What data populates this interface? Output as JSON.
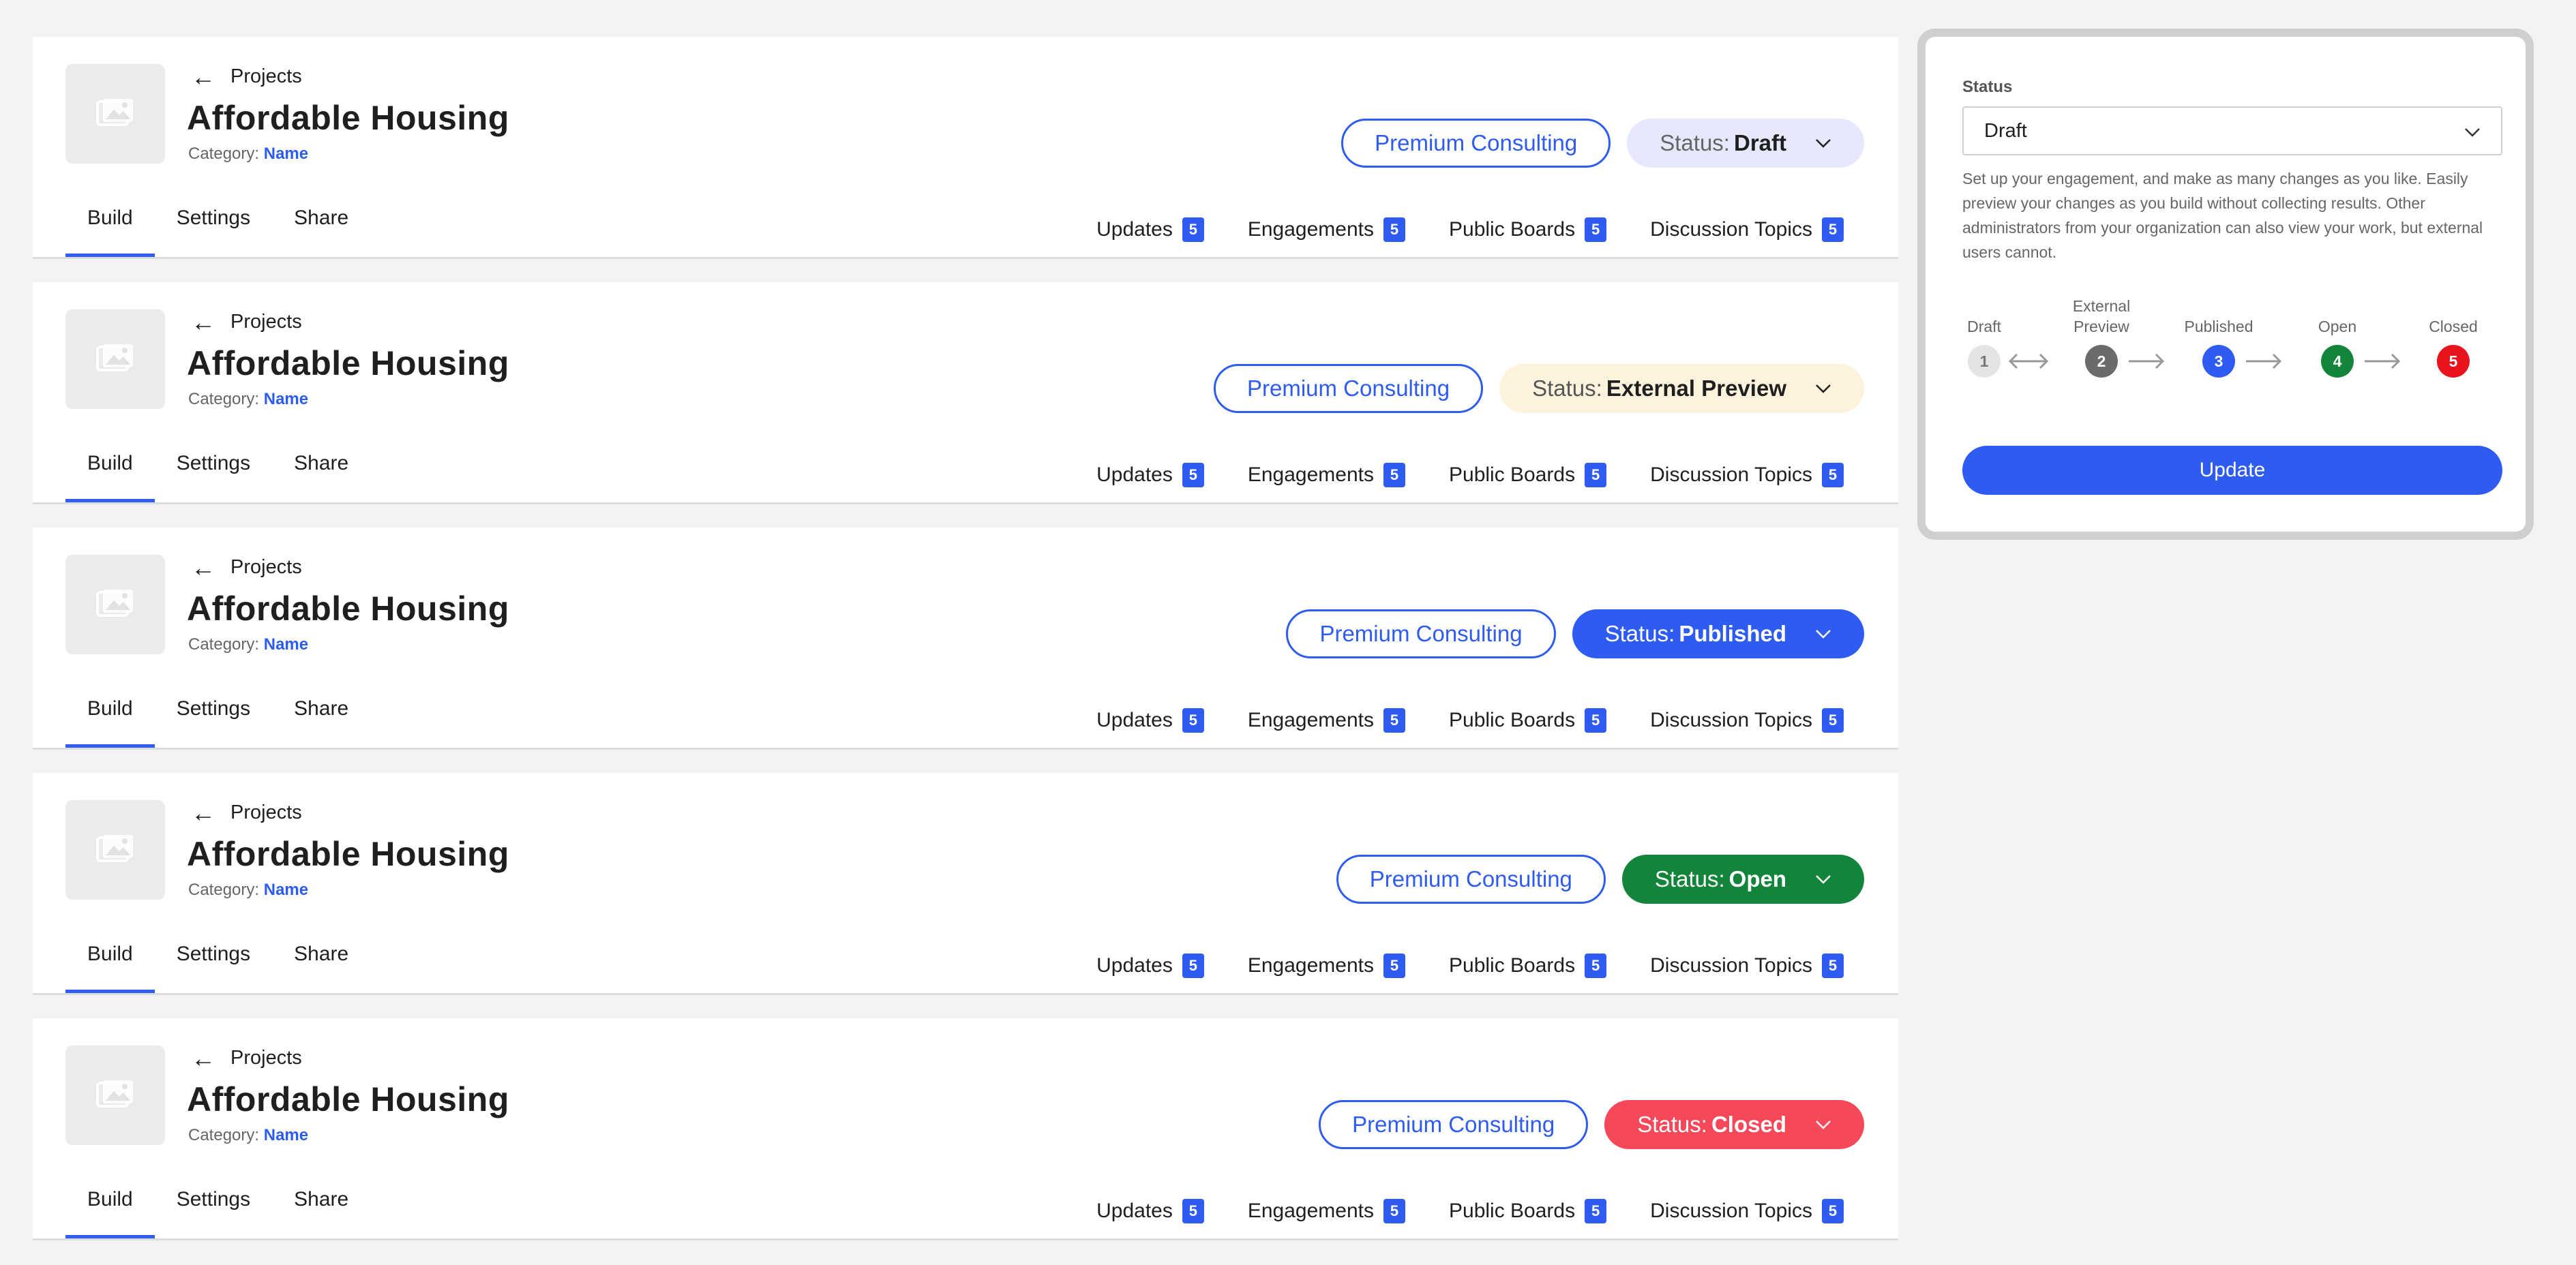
{
  "cards": [
    {
      "back_label": "Projects",
      "title": "Affordable Housing",
      "category_prefix": "Category:",
      "category_name": "Name",
      "premium_label": "Premium Consulting",
      "status_prefix": "Status:",
      "status_value": "Draft",
      "status_bg": "#e6e8fb",
      "status_fg": "#666666",
      "status_value_fg": "#1f1f1f",
      "tabs": [
        "Build",
        "Settings",
        "Share"
      ],
      "counts": [
        {
          "label": "Updates",
          "count": "5"
        },
        {
          "label": "Engagements",
          "count": "5"
        },
        {
          "label": "Public Boards",
          "count": "5"
        },
        {
          "label": "Discussion Topics",
          "count": "5"
        }
      ]
    },
    {
      "back_label": "Projects",
      "title": "Affordable Housing",
      "category_prefix": "Category:",
      "category_name": "Name",
      "premium_label": "Premium Consulting",
      "status_prefix": "Status:",
      "status_value": "External Preview",
      "status_bg": "#fdf3dc",
      "status_fg": "#555555",
      "status_value_fg": "#1f1f1f",
      "tabs": [
        "Build",
        "Settings",
        "Share"
      ],
      "counts": [
        {
          "label": "Updates",
          "count": "5"
        },
        {
          "label": "Engagements",
          "count": "5"
        },
        {
          "label": "Public Boards",
          "count": "5"
        },
        {
          "label": "Discussion Topics",
          "count": "5"
        }
      ]
    },
    {
      "back_label": "Projects",
      "title": "Affordable Housing",
      "category_prefix": "Category:",
      "category_name": "Name",
      "premium_label": "Premium Consulting",
      "status_prefix": "Status:",
      "status_value": "Published",
      "status_bg": "#2f5cf0",
      "status_fg": "#ffffff",
      "status_value_fg": "#ffffff",
      "tabs": [
        "Build",
        "Settings",
        "Share"
      ],
      "counts": [
        {
          "label": "Updates",
          "count": "5"
        },
        {
          "label": "Engagements",
          "count": "5"
        },
        {
          "label": "Public Boards",
          "count": "5"
        },
        {
          "label": "Discussion Topics",
          "count": "5"
        }
      ]
    },
    {
      "back_label": "Projects",
      "title": "Affordable Housing",
      "category_prefix": "Category:",
      "category_name": "Name",
      "premium_label": "Premium Consulting",
      "status_prefix": "Status:",
      "status_value": "Open",
      "status_bg": "#13853a",
      "status_fg": "#ffffff",
      "status_value_fg": "#ffffff",
      "tabs": [
        "Build",
        "Settings",
        "Share"
      ],
      "counts": [
        {
          "label": "Updates",
          "count": "5"
        },
        {
          "label": "Engagements",
          "count": "5"
        },
        {
          "label": "Public Boards",
          "count": "5"
        },
        {
          "label": "Discussion Topics",
          "count": "5"
        }
      ]
    },
    {
      "back_label": "Projects",
      "title": "Affordable Housing",
      "category_prefix": "Category:",
      "category_name": "Name",
      "premium_label": "Premium Consulting",
      "status_prefix": "Status:",
      "status_value": "Closed",
      "status_bg": "#f64859",
      "status_fg": "#ffffff",
      "status_value_fg": "#ffffff",
      "tabs": [
        "Build",
        "Settings",
        "Share"
      ],
      "counts": [
        {
          "label": "Updates",
          "count": "5"
        },
        {
          "label": "Engagements",
          "count": "5"
        },
        {
          "label": "Public Boards",
          "count": "5"
        },
        {
          "label": "Discussion Topics",
          "count": "5"
        }
      ]
    }
  ],
  "panel": {
    "label": "Status",
    "select_value": "Draft",
    "description": "Set up your engagement, and make as many changes as you like. Easily preview your changes as you build without collecting results. Other administrators from your organization can also view your work, but external users cannot.",
    "steps": [
      {
        "label": "Draft",
        "num": "1",
        "bg": "#e4e4e4",
        "fg": "#777777"
      },
      {
        "label": "External Preview",
        "num": "2",
        "bg": "#6b6b6b",
        "fg": "#ffffff"
      },
      {
        "label": "Published",
        "num": "3",
        "bg": "#2f5cf0",
        "fg": "#ffffff"
      },
      {
        "label": "Open",
        "num": "4",
        "bg": "#13853a",
        "fg": "#ffffff"
      },
      {
        "label": "Closed",
        "num": "5",
        "bg": "#e8131c",
        "fg": "#ffffff"
      }
    ],
    "update_label": "Update"
  }
}
